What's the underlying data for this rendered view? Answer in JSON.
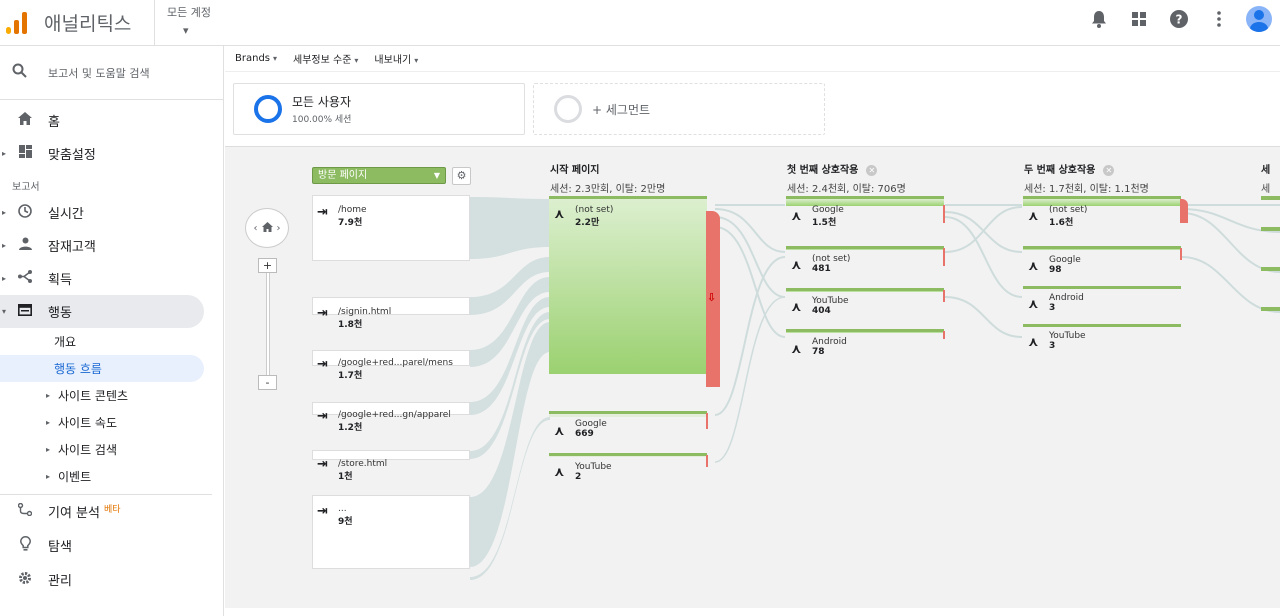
{
  "header": {
    "app_title": "애널리틱스",
    "account_label": "모든 계정",
    "account_caret": "▾"
  },
  "sidebar": {
    "search_placeholder": "보고서 및 도움말 검색",
    "home": "홈",
    "custom": "맞춤설정",
    "reports_label": "보고서",
    "realtime": "실시간",
    "audience": "잠재고객",
    "acquisition": "획득",
    "behavior": "행동",
    "overview": "개요",
    "behavior_flow": "행동 흐름",
    "site_content": "사이트 콘텐츠",
    "site_speed": "사이트 속도",
    "site_search": "사이트 검색",
    "events": "이벤트",
    "attribution": "기여 분석",
    "beta": "베타",
    "discover": "탐색",
    "admin": "관리"
  },
  "toolbar": {
    "brands": "Brands",
    "detail_level": "세부정보 수준",
    "export": "내보내기"
  },
  "segments": {
    "all_users": "모든 사용자",
    "all_users_pct": "100.00% 세션",
    "add_segment": "+ 세그먼트"
  },
  "flow": {
    "dimension_select": "방문 페이지",
    "columns": [
      {
        "title": "시작 페이지",
        "sub": "세션: 2.3만회, 이탈: 2만명"
      },
      {
        "title": "첫 번째 상호작용",
        "sub": "세션: 2.4천회, 이탈: 706명"
      },
      {
        "title": "두 번째 상호작용",
        "sub": "세션: 1.7천회, 이탈: 1.1천명"
      },
      {
        "title": "세",
        "sub": "세"
      }
    ],
    "sources": [
      {
        "label": "/home",
        "value": "7.9천"
      },
      {
        "label": "/signin.html",
        "value": "1.8천"
      },
      {
        "label": "/google+red...parel/mens",
        "value": "1.7천"
      },
      {
        "label": "/google+red...gn/apparel",
        "value": "1.2천"
      },
      {
        "label": "/store.html",
        "value": "1천"
      },
      {
        "label": "...",
        "value": "9천"
      }
    ],
    "start_pages": [
      {
        "label": "(not set)",
        "value": "2.2만"
      },
      {
        "label": "Google",
        "value": "669"
      },
      {
        "label": "YouTube",
        "value": "2"
      }
    ],
    "first_interaction": [
      {
        "label": "Google",
        "value": "1.5천"
      },
      {
        "label": "(not set)",
        "value": "481"
      },
      {
        "label": "YouTube",
        "value": "404"
      },
      {
        "label": "Android",
        "value": "78"
      }
    ],
    "second_interaction": [
      {
        "label": "(not set)",
        "value": "1.6천"
      },
      {
        "label": "Google",
        "value": "98"
      },
      {
        "label": "Android",
        "value": "3"
      },
      {
        "label": "YouTube",
        "value": "3"
      }
    ]
  },
  "colors": {
    "accent": "#1a73e8",
    "node_green": "#8dbb62",
    "dropoff_red": "#e8736a",
    "link": "#1967d2"
  }
}
